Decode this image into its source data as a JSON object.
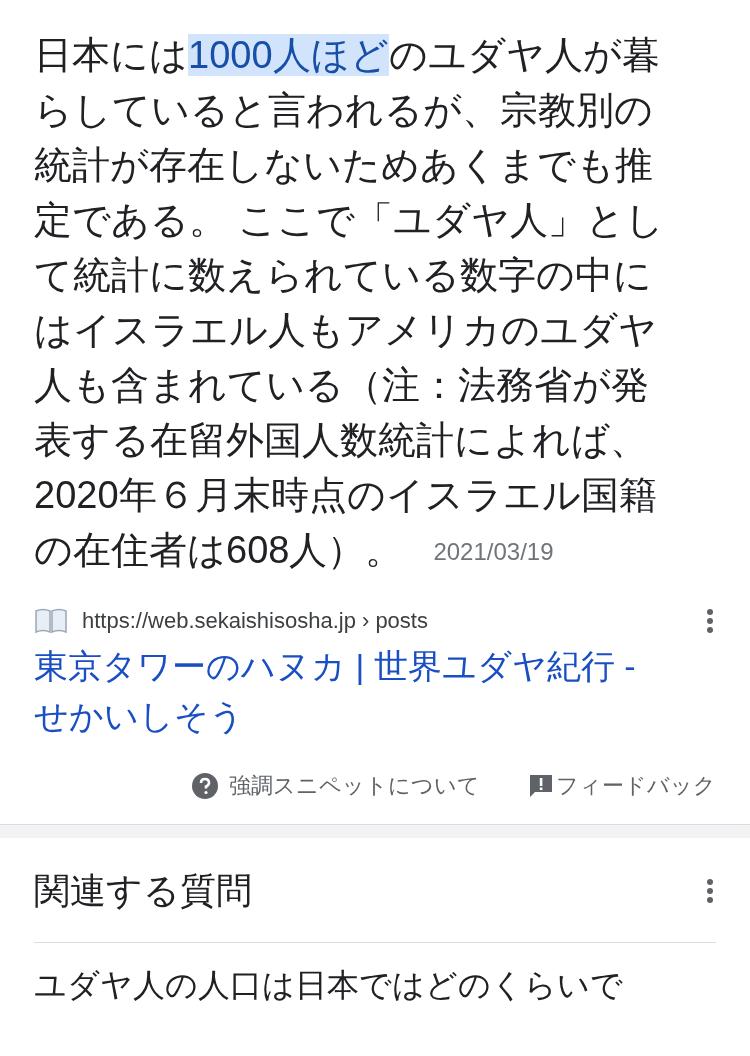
{
  "snippet": {
    "text_before": "日本には",
    "highlighted": "1000人ほど",
    "text_after": "のユダヤ人が暮らしていると言われるが、宗教別の統計が存在しないためあくまでも推定である。 ここで「ユダヤ人」として統計に数えられている数字の中にはイスラエル人もアメリカのユダヤ人も含まれている（注：法務省が発表する在留外国人数統計によれば、2020年６月末時点のイスラエル国籍の在住者は608人）。",
    "date": "2021/03/19"
  },
  "source": {
    "url": "https://web.sekaishisosha.jp",
    "path": "› posts",
    "title": "東京タワーのハヌカ | 世界ユダヤ紀行 - せかいしそう"
  },
  "footer": {
    "about": "強調スニペットについて",
    "feedback": "フィードバック"
  },
  "related": {
    "heading": "関連する質問",
    "questions": [
      "ユダヤ人の人口は日本ではどのくらいで"
    ]
  }
}
